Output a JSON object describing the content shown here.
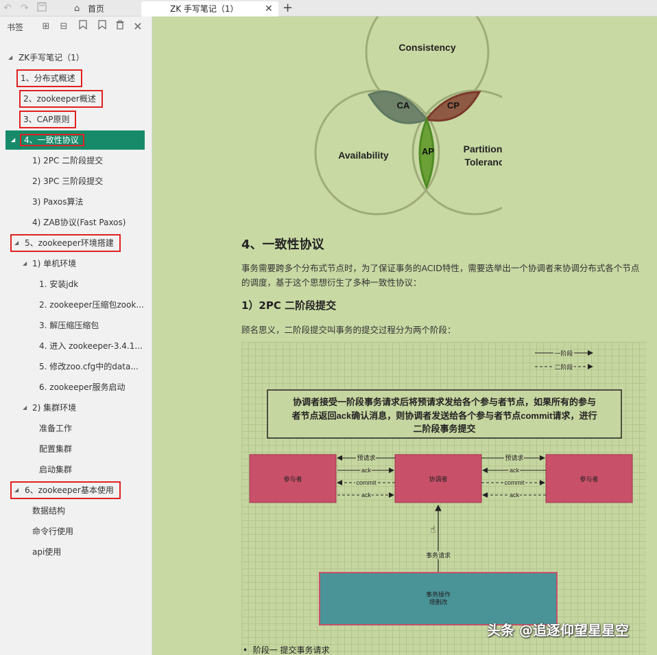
{
  "tabbar": {
    "undo_icon": "undo-icon",
    "redo_icon": "redo-icon",
    "save_icon": "save-icon",
    "home_tab": "首页",
    "active_tab": "ZK 手写笔记（1）",
    "close_glyph": "✕",
    "add_glyph": "+"
  },
  "sidebar": {
    "title": "书签",
    "tree": [
      {
        "label": "ZK手写笔记（1）"
      },
      {
        "label": "1、分布式概述"
      },
      {
        "label": "2、zookeeper概述"
      },
      {
        "label": "3、CAP原则"
      },
      {
        "label": "4、一致性协议"
      },
      {
        "label": "1) 2PC 二阶段提交"
      },
      {
        "label": "2) 3PC 三阶段提交"
      },
      {
        "label": "3) Paxos算法"
      },
      {
        "label": "4) ZAB协议(Fast Paxos)"
      },
      {
        "label": "5、zookeeper环境搭建"
      },
      {
        "label": "1) 单机环境"
      },
      {
        "label": "1. 安装jdk"
      },
      {
        "label": "2. zookeeper压缩包zook..."
      },
      {
        "label": "3. 解压缩压缩包"
      },
      {
        "label": "4. 进入 zookeeper-3.4.1..."
      },
      {
        "label": "5. 修改zoo.cfg中的data..."
      },
      {
        "label": "6. zookeeper服务启动"
      },
      {
        "label": "2) 集群环境"
      },
      {
        "label": "准备工作"
      },
      {
        "label": "配置集群"
      },
      {
        "label": "启动集群"
      },
      {
        "label": "6、zookeeper基本使用"
      },
      {
        "label": "数据结构"
      },
      {
        "label": "命令行使用"
      },
      {
        "label": "api使用"
      }
    ]
  },
  "cap": {
    "consistency": "Consistency",
    "availability": "Availability",
    "partition_line1": "Partition",
    "partition_line2": "Tolerance",
    "ca": "CA",
    "cp": "CP",
    "ap": "AP"
  },
  "doc": {
    "title": "4、一致性协议",
    "paragraph": "事务需要跨多个分布式节点时，为了保证事务的ACID特性，需要选举出一个协调者来协调分布式各个节点的调度，基于这个思想衍生了多种一致性协议：",
    "subtitle": "1）2PC 二阶段提交",
    "paragraph2": "顾名思义，二阶段提交叫事务的提交过程分为两个阶段：",
    "bullet": "阶段一 提交事务请求"
  },
  "diagram": {
    "legend_phase1": "一阶段",
    "legend_phase2": "二阶段",
    "note_line1": "协调者接受一阶段事务请求后将预请求发给各个参与者节点，如果所有的参与",
    "note_line2": "者节点返回ack确认消息，则协调者发送给各个参与者节点commit请求，进行",
    "note_line3": "二阶段事务提交",
    "participant": "参与者",
    "coordinator": "协调者",
    "prerequest": "预请求",
    "ack": "ack",
    "commit": "commit",
    "txn_request": "事务请求",
    "txn_box_line1": "事务操作",
    "txn_box_line2": "增删改"
  },
  "watermark": "头条 @追逐仰望星星空",
  "colors": {
    "selected": "#178a6a",
    "highlight_border": "#e02020",
    "content_bg": "#c8d9a3",
    "node_red": "#c85068",
    "node_teal": "#4a9498"
  }
}
